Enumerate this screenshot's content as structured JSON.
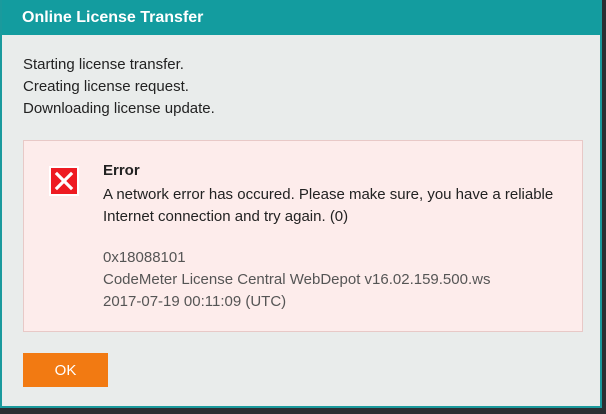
{
  "window": {
    "title": "Online License Transfer"
  },
  "log": {
    "lines": [
      "Starting license transfer.",
      "Creating license request.",
      "Downloading license update."
    ]
  },
  "error": {
    "icon": "error-x-icon",
    "title": "Error",
    "message": "A network error has occured. Please make sure, you have a reliable Internet connection and try again. (0)",
    "code": "0x18088101",
    "server": "CodeMeter License Central WebDepot v16.02.159.500.ws",
    "timestamp": "2017-07-19 00:11:09 (UTC)"
  },
  "buttons": {
    "ok_label": "OK"
  },
  "colors": {
    "titlebar": "#139c9f",
    "dialog_bg": "#e9eceb",
    "error_bg": "#fdeceb",
    "error_icon": "#ee1b22",
    "ok_button": "#f27a12"
  }
}
